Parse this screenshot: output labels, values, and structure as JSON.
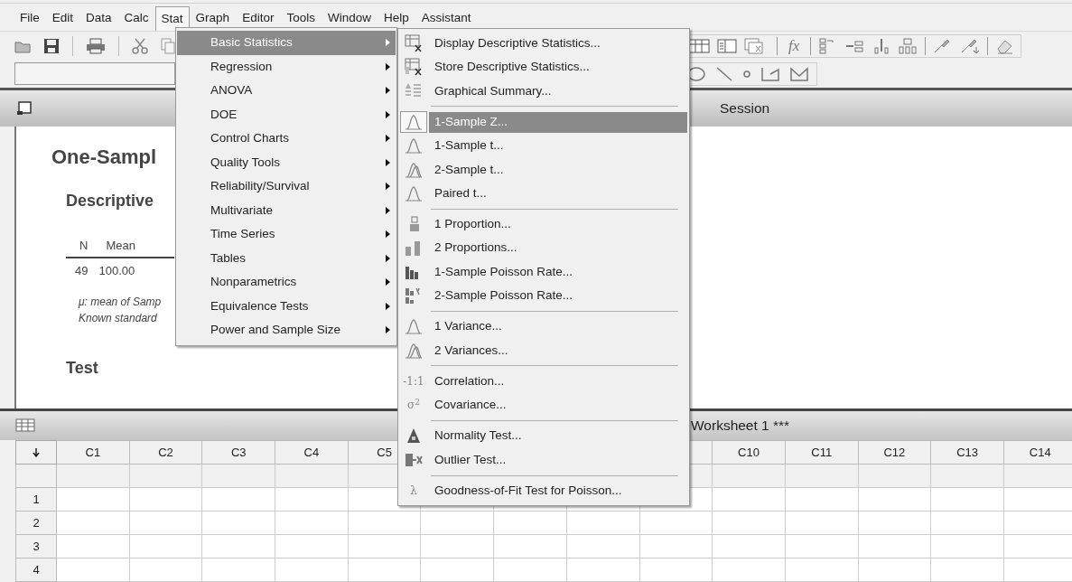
{
  "menu_bar": [
    {
      "label": "File",
      "selected": false
    },
    {
      "label": "Edit",
      "selected": false
    },
    {
      "label": "Data",
      "selected": false
    },
    {
      "label": "Calc",
      "selected": false
    },
    {
      "label": "Stat",
      "selected": true
    },
    {
      "label": "Graph",
      "selected": false
    },
    {
      "label": "Editor",
      "selected": false
    },
    {
      "label": "Tools",
      "selected": false
    },
    {
      "label": "Window",
      "selected": false
    },
    {
      "label": "Help",
      "selected": false
    },
    {
      "label": "Assistant",
      "selected": false
    }
  ],
  "toolbar": {
    "function_glyph": "fx"
  },
  "session": {
    "title": "Session",
    "output_title": "One-Sampl",
    "section_title": "Descriptive",
    "table_headers": [
      "N",
      "Mean"
    ],
    "table_row": [
      "49",
      "100.00"
    ],
    "notes": [
      "μ: mean of Samp",
      "Known standard"
    ],
    "section_2_title": "Test"
  },
  "worksheet": {
    "title": "Worksheet 1 ***",
    "columns": [
      {
        "label": "C1"
      },
      {
        "label": "C2"
      },
      {
        "label": "C3"
      },
      {
        "label": "C4"
      },
      {
        "label": "C5"
      },
      {},
      {},
      {},
      {},
      {
        "label": "C10"
      },
      {
        "label": "C11"
      },
      {
        "label": "C12"
      },
      {
        "label": "C13"
      },
      {
        "label": "C14"
      }
    ],
    "rows": [
      "1",
      "2",
      "3",
      "4"
    ]
  },
  "stat_menu": [
    {
      "label": "Basic Statistics",
      "selected": true,
      "submenu": true
    },
    {
      "label": "Regression",
      "selected": false,
      "submenu": true
    },
    {
      "label": "ANOVA",
      "selected": false,
      "submenu": true
    },
    {
      "label": "DOE",
      "selected": false,
      "submenu": true
    },
    {
      "label": "Control Charts",
      "selected": false,
      "submenu": true
    },
    {
      "label": "Quality Tools",
      "selected": false,
      "submenu": true
    },
    {
      "label": "Reliability/Survival",
      "selected": false,
      "submenu": true
    },
    {
      "label": "Multivariate",
      "selected": false,
      "submenu": true
    },
    {
      "label": "Time Series",
      "selected": false,
      "submenu": true
    },
    {
      "label": "Tables",
      "selected": false,
      "submenu": true
    },
    {
      "label": "Nonparametrics",
      "selected": false,
      "submenu": true
    },
    {
      "label": "Equivalence Tests",
      "selected": false,
      "submenu": true
    },
    {
      "label": "Power and Sample Size",
      "selected": false,
      "submenu": true
    }
  ],
  "basic_statistics_menu": [
    {
      "kind": "item",
      "label": "Display Descriptive Statistics...",
      "selected": false
    },
    {
      "kind": "item",
      "label": "Store Descriptive Statistics...",
      "selected": false
    },
    {
      "kind": "item",
      "label": "Graphical Summary...",
      "selected": false
    },
    {
      "kind": "separator"
    },
    {
      "kind": "item",
      "label": "1-Sample Z...",
      "selected": true
    },
    {
      "kind": "item",
      "label": "1-Sample t...",
      "selected": false
    },
    {
      "kind": "item",
      "label": "2-Sample t...",
      "selected": false
    },
    {
      "kind": "item",
      "label": "Paired t...",
      "selected": false
    },
    {
      "kind": "separator"
    },
    {
      "kind": "item",
      "label": "1 Proportion...",
      "selected": false
    },
    {
      "kind": "item",
      "label": "2 Proportions...",
      "selected": false
    },
    {
      "kind": "item",
      "label": "1-Sample Poisson Rate...",
      "selected": false
    },
    {
      "kind": "item",
      "label": "2-Sample Poisson Rate...",
      "selected": false
    },
    {
      "kind": "separator"
    },
    {
      "kind": "item",
      "label": "1 Variance...",
      "selected": false
    },
    {
      "kind": "item",
      "label": "2 Variances...",
      "selected": false
    },
    {
      "kind": "separator"
    },
    {
      "kind": "item",
      "label": "Correlation...",
      "selected": false,
      "glyph": "-1:1"
    },
    {
      "kind": "item",
      "label": "Covariance...",
      "selected": false,
      "glyph": "σ$^{2}$"
    },
    {
      "kind": "separator"
    },
    {
      "kind": "item",
      "label": "Normality Test...",
      "selected": false
    },
    {
      "kind": "item",
      "label": "Outlier Test...",
      "selected": false
    },
    {
      "kind": "separator"
    },
    {
      "kind": "item",
      "label": "Goodness-of-Fit Test for Poisson...",
      "selected": false,
      "glyph": "λ"
    }
  ]
}
